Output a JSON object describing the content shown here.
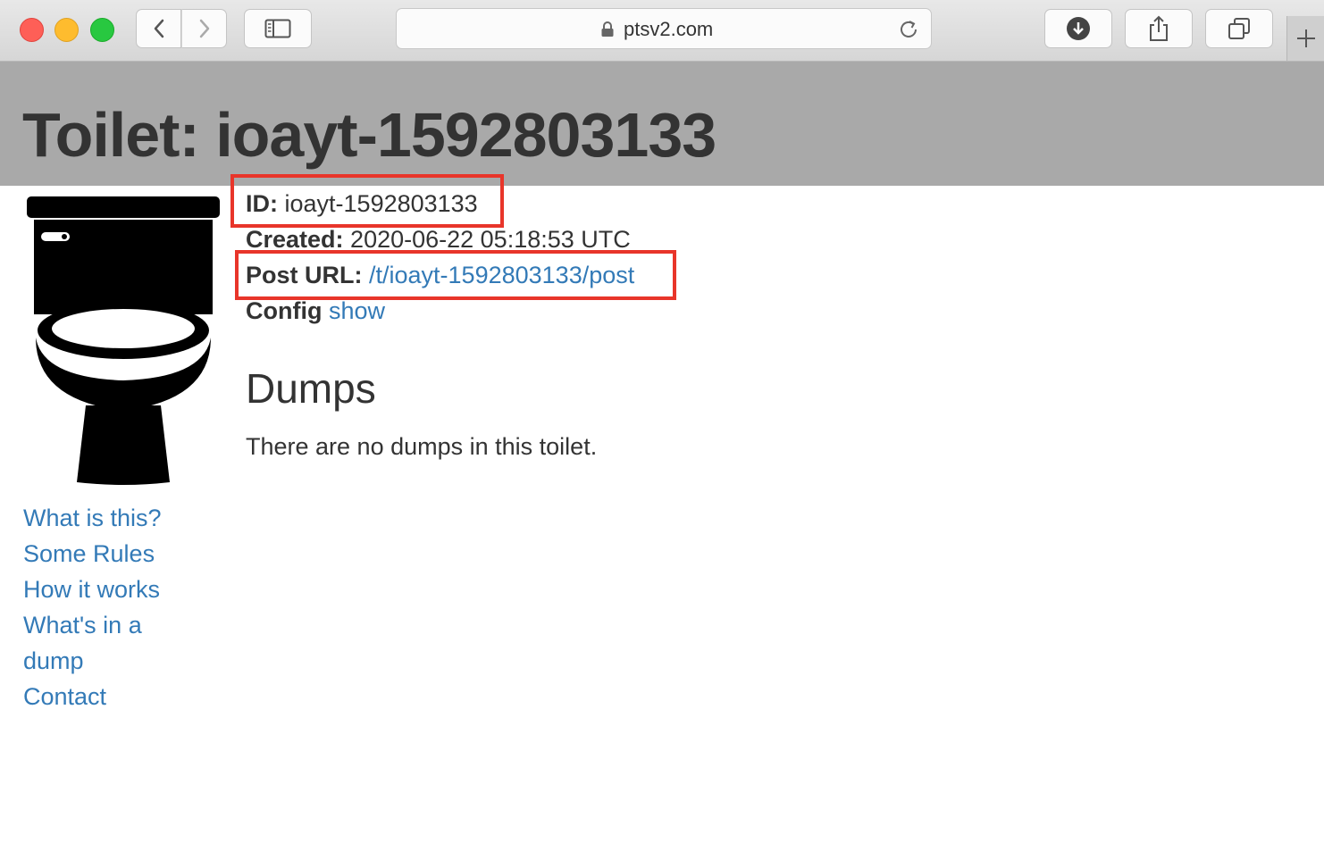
{
  "browser": {
    "url": "ptsv2.com"
  },
  "page": {
    "title": "Toilet: ioayt-1592803133"
  },
  "info": {
    "id_label": "ID:",
    "id_value": "ioayt-1592803133",
    "created_label": "Created:",
    "created_value": "2020-06-22 05:18:53 UTC",
    "post_url_label": "Post URL:",
    "post_url_value": "/t/ioayt-1592803133/post",
    "config_label": "Config",
    "config_link": "show"
  },
  "dumps": {
    "heading": "Dumps",
    "empty_message": "There are no dumps in this toilet."
  },
  "sidebar": {
    "links": [
      "What is this?",
      "Some Rules",
      "How it works",
      "What's in a",
      "dump",
      "Contact"
    ]
  },
  "colors": {
    "link": "#337ab7",
    "header_band": "#a9a9a9",
    "highlight": "#e8352a"
  }
}
